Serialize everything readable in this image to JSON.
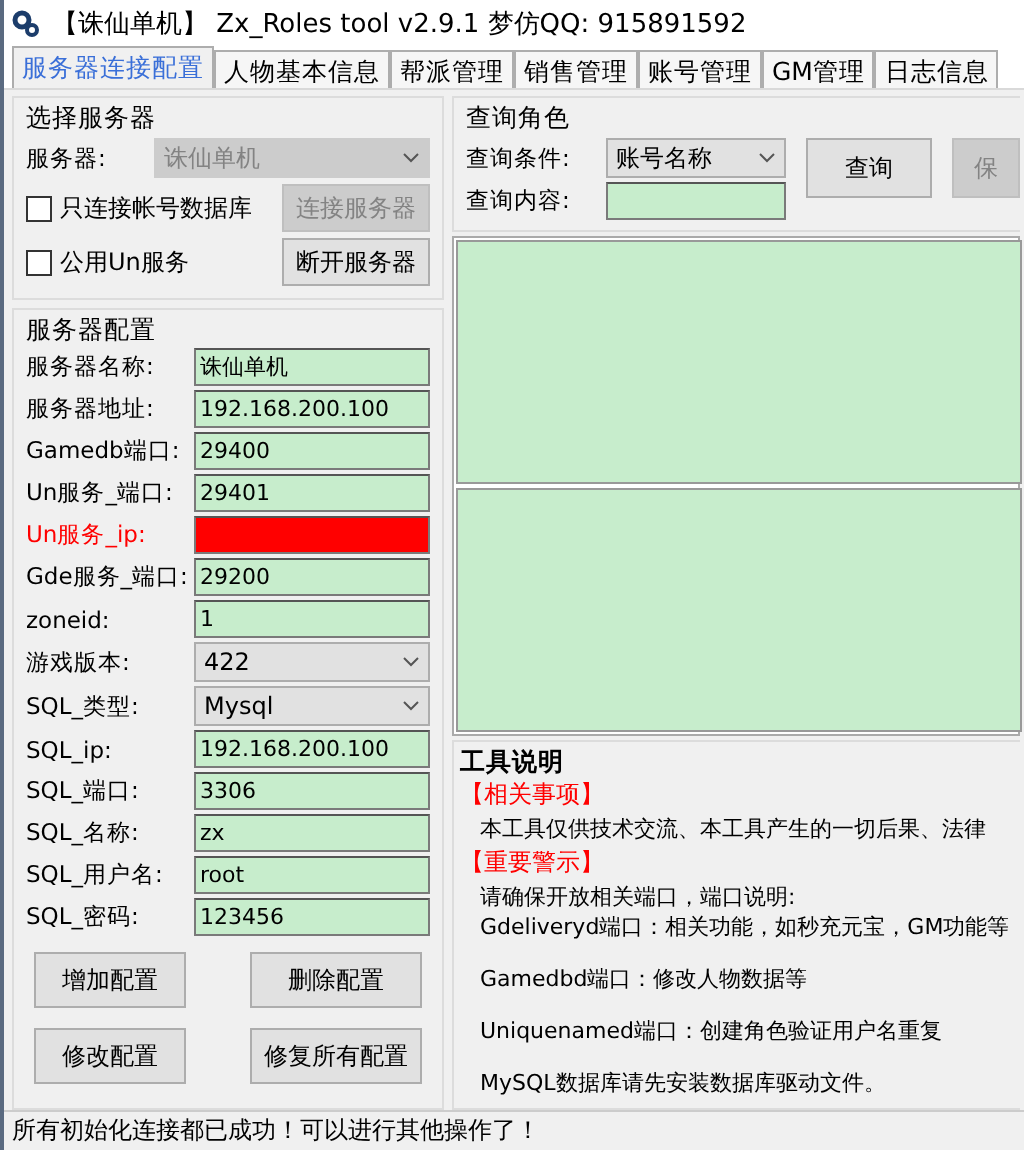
{
  "window": {
    "title": "【诛仙单机】 Zx_Roles tool v2.9.1 梦仿QQ: 915891592"
  },
  "tabs": [
    {
      "label": "服务器连接配置",
      "selected": true
    },
    {
      "label": "人物基本信息",
      "selected": false
    },
    {
      "label": "帮派管理",
      "selected": false
    },
    {
      "label": "销售管理",
      "selected": false
    },
    {
      "label": "账号管理",
      "selected": false
    },
    {
      "label": "GM管理",
      "selected": false
    },
    {
      "label": "日志信息",
      "selected": false
    }
  ],
  "server_select": {
    "title": "选择服务器",
    "server_label": "服务器:",
    "server_value": "诛仙单机",
    "server_disabled": true,
    "checkboxes": [
      {
        "label": "只连接帐号数据库",
        "checked": false
      },
      {
        "label": "公用Un服务",
        "checked": false
      }
    ],
    "buttons": [
      {
        "label": "连接服务器",
        "disabled": true
      },
      {
        "label": "断开服务器",
        "disabled": false
      }
    ]
  },
  "server_config": {
    "title": "服务器配置",
    "fields": [
      {
        "label": "服务器名称:",
        "value": "诛仙单机",
        "kind": "input",
        "error": false
      },
      {
        "label": "服务器地址:",
        "value": "192.168.200.100",
        "kind": "input",
        "error": false
      },
      {
        "label": "Gamedb端口:",
        "value": "29400",
        "kind": "input",
        "error": false
      },
      {
        "label": "Un服务_端口:",
        "value": "29401",
        "kind": "input",
        "error": false
      },
      {
        "label": "Un服务_ip:",
        "kind": "input",
        "error": true
      },
      {
        "label": "Gde服务_端口:",
        "value": "29200",
        "kind": "input",
        "error": false
      },
      {
        "label": "zoneid:",
        "value": "1",
        "kind": "input",
        "error": false
      },
      {
        "label": "游戏版本:",
        "value": "422",
        "kind": "select",
        "error": false
      },
      {
        "label": "SQL_类型:",
        "value": "Mysql",
        "kind": "select",
        "error": false
      },
      {
        "label": "SQL_ip:",
        "value": "192.168.200.100",
        "kind": "input",
        "error": false
      },
      {
        "label": "SQL_端口:",
        "value": "3306",
        "kind": "input",
        "error": false
      },
      {
        "label": "SQL_名称:",
        "value": "zx",
        "kind": "input",
        "error": false
      },
      {
        "label": "SQL_用户名:",
        "value": "root",
        "kind": "input",
        "error": false
      },
      {
        "label": "SQL_密码:",
        "value": "123456",
        "kind": "input",
        "error": false
      }
    ],
    "buttons": [
      {
        "label": "增加配置"
      },
      {
        "label": "删除配置"
      },
      {
        "label": "修改配置"
      },
      {
        "label": "修复所有配置"
      }
    ]
  },
  "query": {
    "title": "查询角色",
    "condition_label": "查询条件:",
    "condition_value": "账号名称",
    "content_label": "查询内容:",
    "buttons": [
      {
        "label": "查询",
        "disabled": false
      },
      {
        "label": "保",
        "disabled": true
      }
    ]
  },
  "tool_info": {
    "title": "工具说明",
    "sections": [
      {
        "heading": "【相关事项】",
        "paragraphs": [
          [
            "本工具仅供技术交流、本工具产生的一切后果、法律"
          ]
        ]
      },
      {
        "heading": "【重要警示】",
        "paragraphs": [
          [
            "请确保开放相关端口，端口说明:",
            "Gdeliveryd端口：相关功能，如秒充元宝，GM功能等"
          ],
          [
            "Gamedbd端口：修改人物数据等"
          ],
          [
            "Uniquenamed端口：创建角色验证用户名重复"
          ],
          [
            "MySQL数据库请先安装数据库驱动文件。"
          ]
        ]
      }
    ]
  },
  "status_bar": "所有初始化连接都已成功！可以进行其他操作了！"
}
